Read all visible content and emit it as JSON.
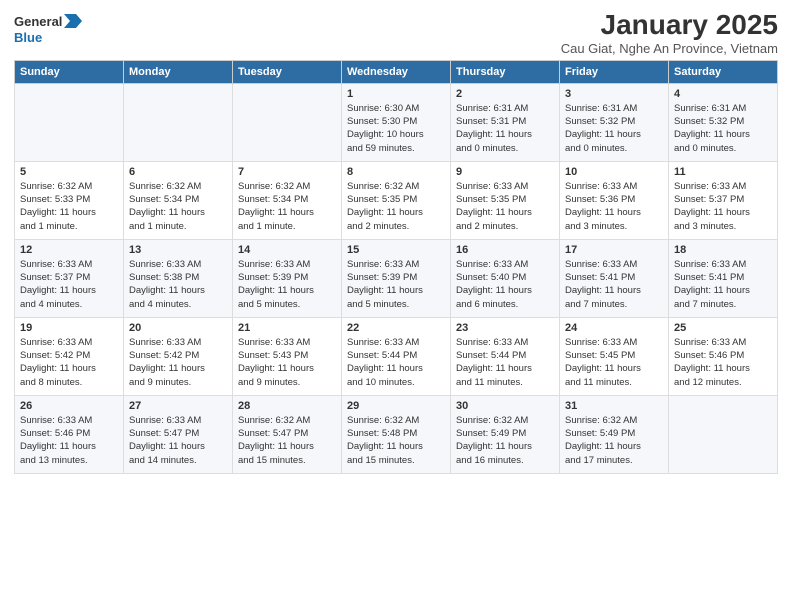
{
  "app": {
    "logo_line1": "General",
    "logo_line2": "Blue",
    "title": "January 2025",
    "subtitle": "Cau Giat, Nghe An Province, Vietnam"
  },
  "calendar": {
    "headers": [
      "Sunday",
      "Monday",
      "Tuesday",
      "Wednesday",
      "Thursday",
      "Friday",
      "Saturday"
    ],
    "weeks": [
      [
        {
          "day": "",
          "text": ""
        },
        {
          "day": "",
          "text": ""
        },
        {
          "day": "",
          "text": ""
        },
        {
          "day": "1",
          "text": "Sunrise: 6:30 AM\nSunset: 5:30 PM\nDaylight: 10 hours\nand 59 minutes."
        },
        {
          "day": "2",
          "text": "Sunrise: 6:31 AM\nSunset: 5:31 PM\nDaylight: 11 hours\nand 0 minutes."
        },
        {
          "day": "3",
          "text": "Sunrise: 6:31 AM\nSunset: 5:32 PM\nDaylight: 11 hours\nand 0 minutes."
        },
        {
          "day": "4",
          "text": "Sunrise: 6:31 AM\nSunset: 5:32 PM\nDaylight: 11 hours\nand 0 minutes."
        }
      ],
      [
        {
          "day": "5",
          "text": "Sunrise: 6:32 AM\nSunset: 5:33 PM\nDaylight: 11 hours\nand 1 minute."
        },
        {
          "day": "6",
          "text": "Sunrise: 6:32 AM\nSunset: 5:34 PM\nDaylight: 11 hours\nand 1 minute."
        },
        {
          "day": "7",
          "text": "Sunrise: 6:32 AM\nSunset: 5:34 PM\nDaylight: 11 hours\nand 1 minute."
        },
        {
          "day": "8",
          "text": "Sunrise: 6:32 AM\nSunset: 5:35 PM\nDaylight: 11 hours\nand 2 minutes."
        },
        {
          "day": "9",
          "text": "Sunrise: 6:33 AM\nSunset: 5:35 PM\nDaylight: 11 hours\nand 2 minutes."
        },
        {
          "day": "10",
          "text": "Sunrise: 6:33 AM\nSunset: 5:36 PM\nDaylight: 11 hours\nand 3 minutes."
        },
        {
          "day": "11",
          "text": "Sunrise: 6:33 AM\nSunset: 5:37 PM\nDaylight: 11 hours\nand 3 minutes."
        }
      ],
      [
        {
          "day": "12",
          "text": "Sunrise: 6:33 AM\nSunset: 5:37 PM\nDaylight: 11 hours\nand 4 minutes."
        },
        {
          "day": "13",
          "text": "Sunrise: 6:33 AM\nSunset: 5:38 PM\nDaylight: 11 hours\nand 4 minutes."
        },
        {
          "day": "14",
          "text": "Sunrise: 6:33 AM\nSunset: 5:39 PM\nDaylight: 11 hours\nand 5 minutes."
        },
        {
          "day": "15",
          "text": "Sunrise: 6:33 AM\nSunset: 5:39 PM\nDaylight: 11 hours\nand 5 minutes."
        },
        {
          "day": "16",
          "text": "Sunrise: 6:33 AM\nSunset: 5:40 PM\nDaylight: 11 hours\nand 6 minutes."
        },
        {
          "day": "17",
          "text": "Sunrise: 6:33 AM\nSunset: 5:41 PM\nDaylight: 11 hours\nand 7 minutes."
        },
        {
          "day": "18",
          "text": "Sunrise: 6:33 AM\nSunset: 5:41 PM\nDaylight: 11 hours\nand 7 minutes."
        }
      ],
      [
        {
          "day": "19",
          "text": "Sunrise: 6:33 AM\nSunset: 5:42 PM\nDaylight: 11 hours\nand 8 minutes."
        },
        {
          "day": "20",
          "text": "Sunrise: 6:33 AM\nSunset: 5:42 PM\nDaylight: 11 hours\nand 9 minutes."
        },
        {
          "day": "21",
          "text": "Sunrise: 6:33 AM\nSunset: 5:43 PM\nDaylight: 11 hours\nand 9 minutes."
        },
        {
          "day": "22",
          "text": "Sunrise: 6:33 AM\nSunset: 5:44 PM\nDaylight: 11 hours\nand 10 minutes."
        },
        {
          "day": "23",
          "text": "Sunrise: 6:33 AM\nSunset: 5:44 PM\nDaylight: 11 hours\nand 11 minutes."
        },
        {
          "day": "24",
          "text": "Sunrise: 6:33 AM\nSunset: 5:45 PM\nDaylight: 11 hours\nand 11 minutes."
        },
        {
          "day": "25",
          "text": "Sunrise: 6:33 AM\nSunset: 5:46 PM\nDaylight: 11 hours\nand 12 minutes."
        }
      ],
      [
        {
          "day": "26",
          "text": "Sunrise: 6:33 AM\nSunset: 5:46 PM\nDaylight: 11 hours\nand 13 minutes."
        },
        {
          "day": "27",
          "text": "Sunrise: 6:33 AM\nSunset: 5:47 PM\nDaylight: 11 hours\nand 14 minutes."
        },
        {
          "day": "28",
          "text": "Sunrise: 6:32 AM\nSunset: 5:47 PM\nDaylight: 11 hours\nand 15 minutes."
        },
        {
          "day": "29",
          "text": "Sunrise: 6:32 AM\nSunset: 5:48 PM\nDaylight: 11 hours\nand 15 minutes."
        },
        {
          "day": "30",
          "text": "Sunrise: 6:32 AM\nSunset: 5:49 PM\nDaylight: 11 hours\nand 16 minutes."
        },
        {
          "day": "31",
          "text": "Sunrise: 6:32 AM\nSunset: 5:49 PM\nDaylight: 11 hours\nand 17 minutes."
        },
        {
          "day": "",
          "text": ""
        }
      ]
    ]
  }
}
